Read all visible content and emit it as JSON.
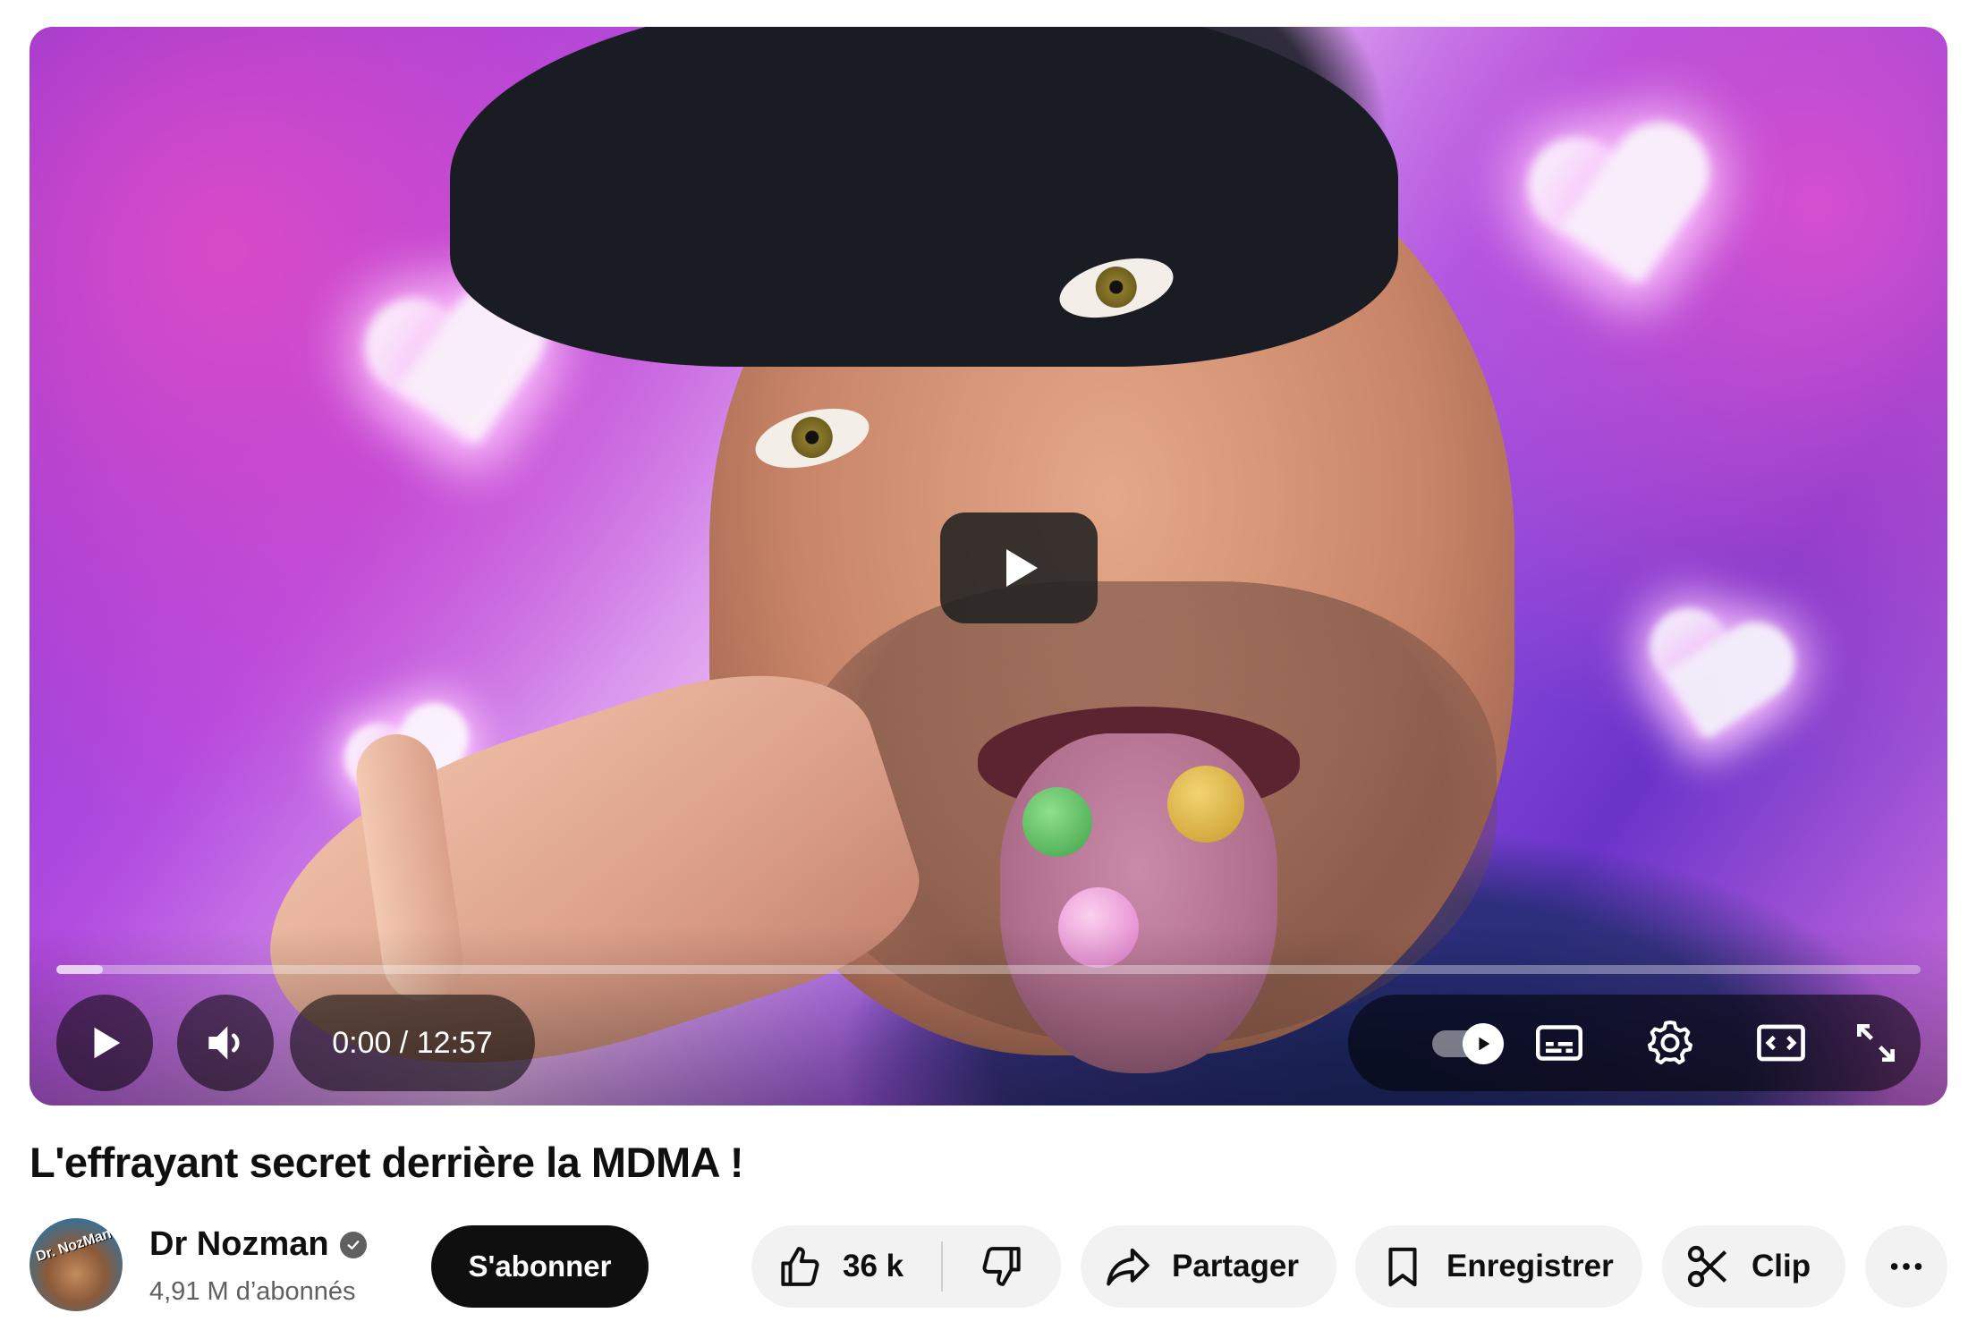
{
  "player": {
    "time_display": "0:00 / 12:57",
    "progress_fraction": 0.0,
    "buffered_fraction": 0.025,
    "colors": {
      "progress": "#ff0000",
      "overlay": "#000000"
    }
  },
  "video": {
    "title": "L'effrayant secret derrière la MDMA !"
  },
  "channel": {
    "name": "Dr Nozman",
    "verified": true,
    "subscribers": "4,91 M d’abonnés",
    "avatar_text": "Dr. NozMan"
  },
  "actions": {
    "subscribe_label": "S'abonner",
    "like_count": "36 k",
    "share_label": "Partager",
    "save_label": "Enregistrer",
    "clip_label": "Clip"
  },
  "icons": {
    "play": "play-icon",
    "volume": "volume-icon",
    "autoplay": "autoplay-toggle-icon",
    "subtitles": "subtitles-icon",
    "settings": "gear-icon",
    "theater": "theater-mode-icon",
    "fullscreen": "fullscreen-icon",
    "like": "thumbs-up-icon",
    "dislike": "thumbs-down-icon",
    "share": "share-arrow-icon",
    "save": "bookmark-icon",
    "clip": "scissors-icon",
    "more": "more-horizontal-icon"
  }
}
